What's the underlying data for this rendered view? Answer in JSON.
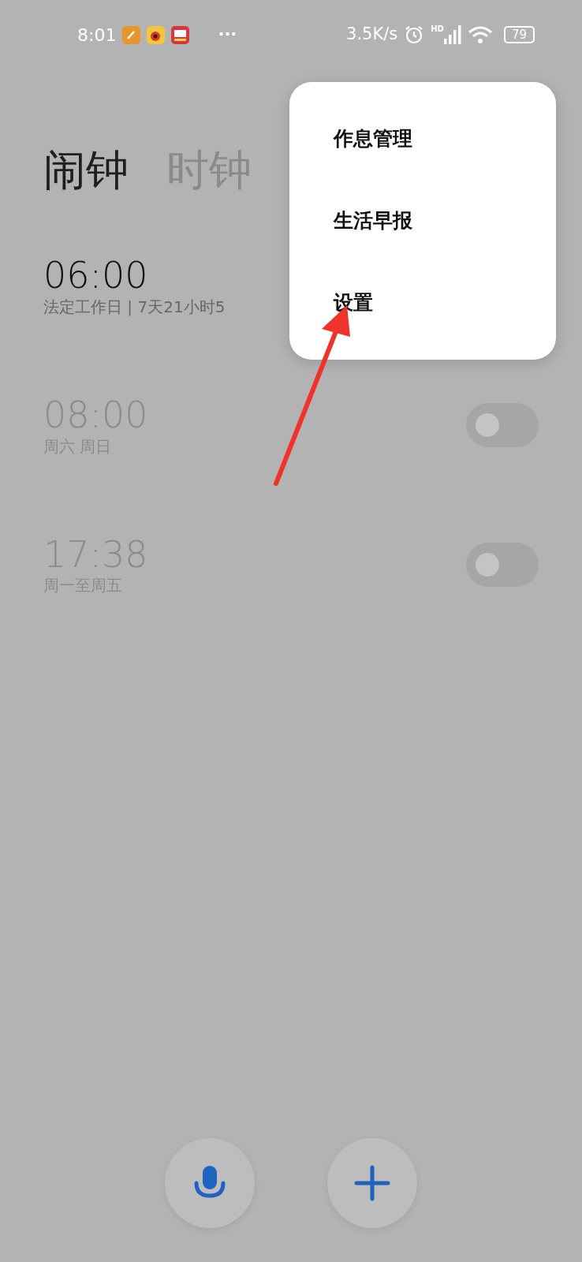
{
  "status_bar": {
    "time": "8:01",
    "more": "···",
    "net_speed": "3.5K/s",
    "signal_label": "HD",
    "battery": "79"
  },
  "tabs": [
    {
      "label": "闹钟",
      "selected": true
    },
    {
      "label": "时钟",
      "selected": false
    }
  ],
  "alarms": [
    {
      "time": "06:00",
      "repeat": "法定工作日 | 7天21小时5",
      "on": true
    },
    {
      "time": "08:00",
      "repeat": "周六 周日",
      "on": false,
      "show_switch": true
    },
    {
      "time": "17:38",
      "repeat": "周一至周五",
      "on": false,
      "show_switch": true
    }
  ],
  "menu": {
    "items": [
      "作息管理",
      "生活早报",
      "设置"
    ]
  }
}
